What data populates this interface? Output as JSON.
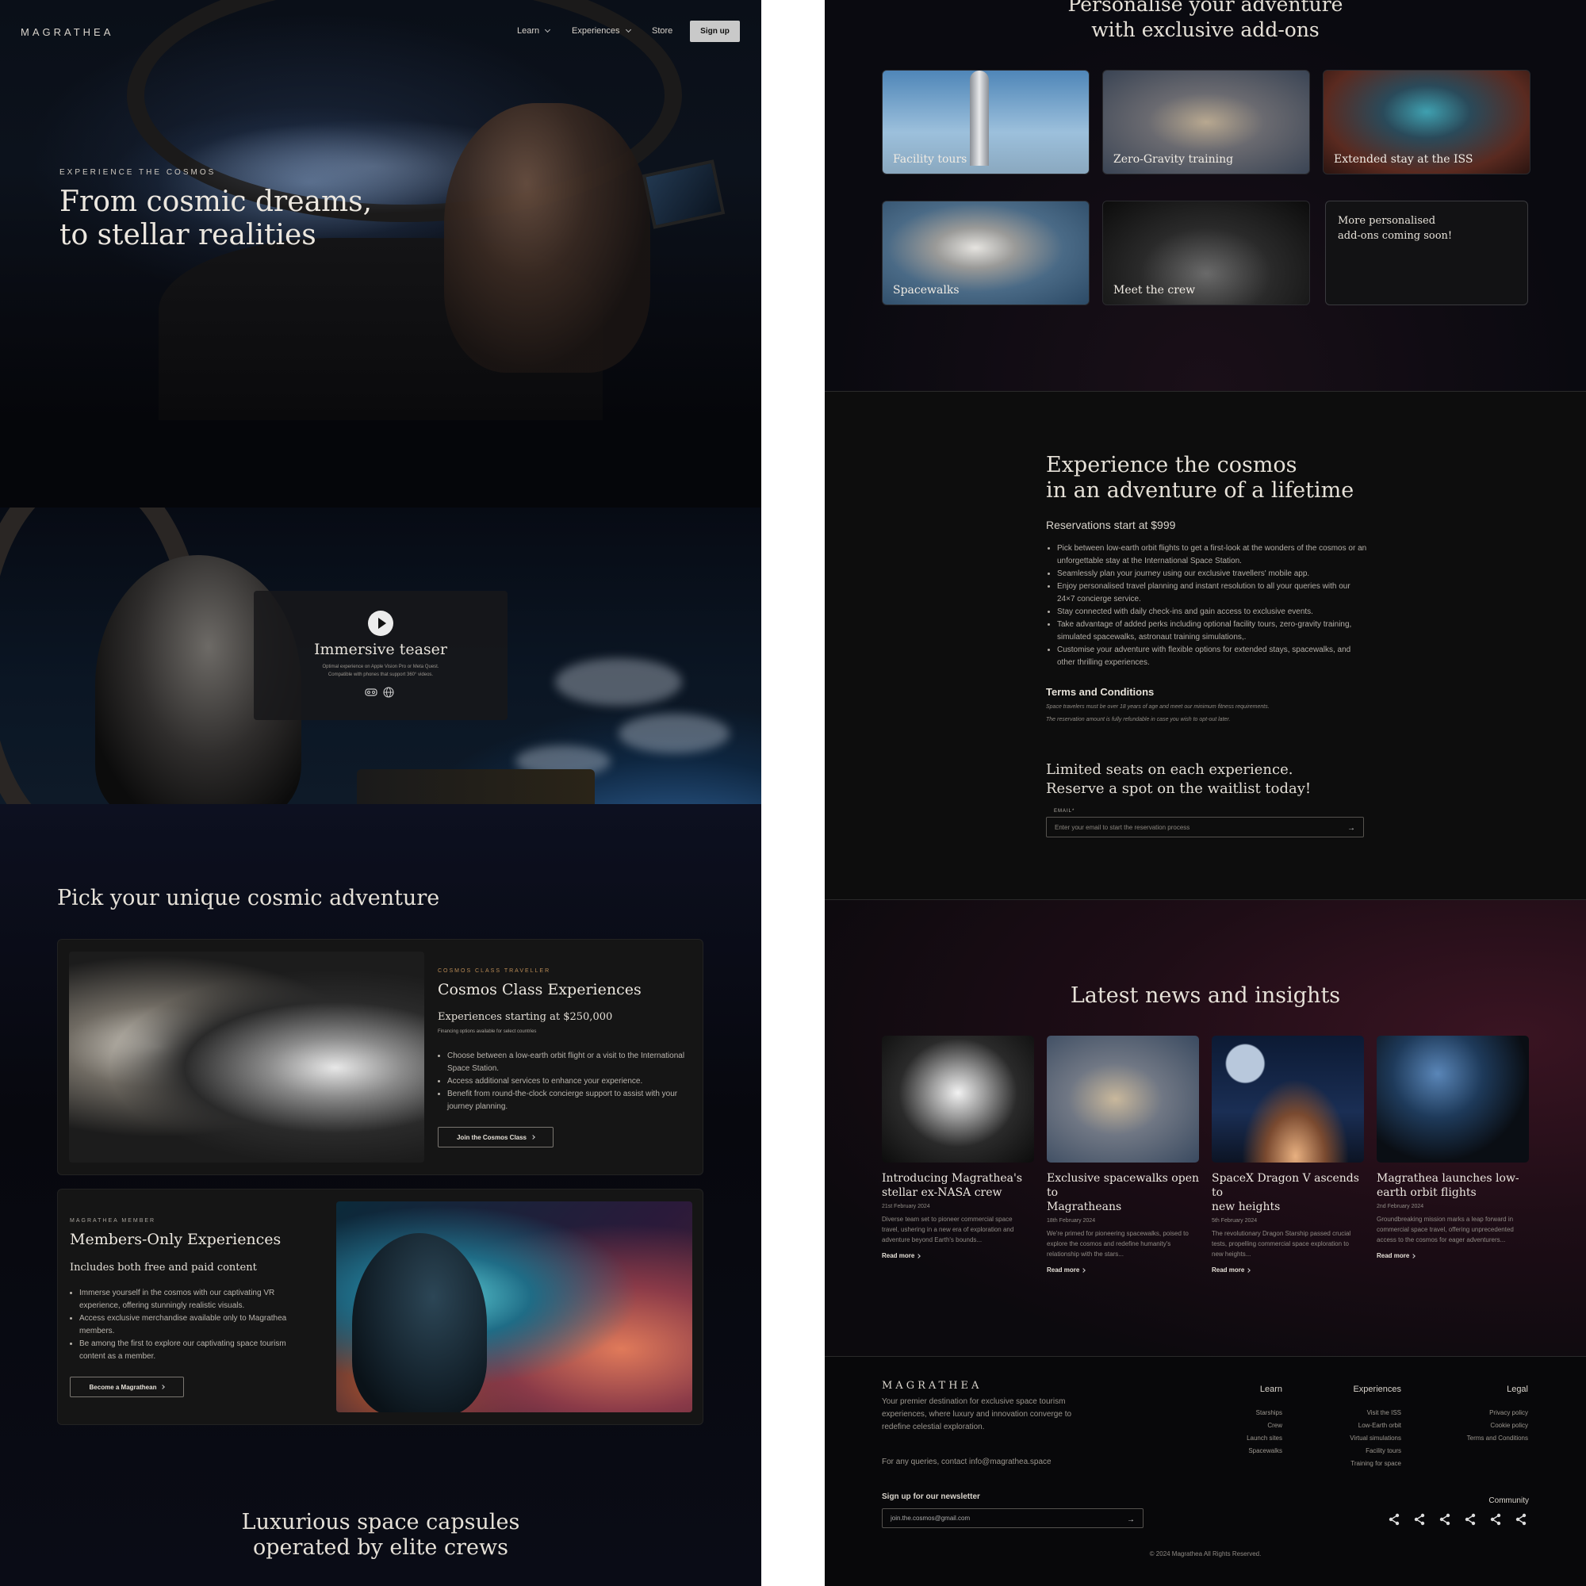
{
  "nav": {
    "logo": "MAGRATHEA",
    "items": [
      {
        "label": "Learn"
      },
      {
        "label": "Experiences"
      },
      {
        "label": "Store"
      }
    ],
    "signup": "Sign up"
  },
  "hero": {
    "kicker": "EXPERIENCE THE COSMOS",
    "line1": "From cosmic dreams,",
    "line2": "to stellar realities"
  },
  "teaser": {
    "title": "Immersive teaser",
    "sub1": "Optimal experience on Apple Vision Pro or Meta Quest.",
    "sub2": "Compatible with phones that support 360° videos.",
    "icons": [
      "vr-headset-icon",
      "globe-icon"
    ]
  },
  "adventure": {
    "heading": "Pick your unique cosmic adventure",
    "cosmos": {
      "kicker": "COSMOS CLASS TRAVELLER",
      "title": "Cosmos Class Experiences",
      "price": "Experiences starting at $250,000",
      "note": "Financing options available for select countries",
      "bullets": [
        "Choose between a low-earth orbit flight or a visit to the International Space Station.",
        "Access additional services to enhance your experience.",
        "Benefit from round-the-clock concierge support to assist with your journey planning."
      ],
      "cta": "Join the Cosmos Class"
    },
    "members": {
      "kicker": "MAGRATHEA MEMBER",
      "title": "Members-Only Experiences",
      "sub": "Includes both free and paid content",
      "bullets": [
        "Immerse yourself in the cosmos with our captivating VR experience, offering stunningly realistic visuals.",
        "Access exclusive merchandise available only to Magrathea members.",
        "Be among the first to explore our captivating space tourism content as a member."
      ],
      "cta": "Become a Magrathean"
    }
  },
  "capsules": {
    "line1": "Luxurious space capsules",
    "line2": "operated by elite crews"
  },
  "addons": {
    "line1": "Personalise your adventure",
    "line2": "with exclusive add-ons",
    "items": [
      {
        "label": "Facility tours"
      },
      {
        "label": "Zero-Gravity training"
      },
      {
        "label": "Extended stay at the ISS"
      },
      {
        "label": "Spacewalks"
      },
      {
        "label": "Meet the crew"
      }
    ],
    "coming_soon_1": "More personalised",
    "coming_soon_2": "add-ons coming soon!"
  },
  "reserve": {
    "line1": "Experience the cosmos",
    "line2": "in an adventure of a lifetime",
    "price": "Reservations start at $999",
    "bullets": [
      "Pick between low-earth orbit flights to get a first-look at the wonders of the cosmos or an unforgettable stay at the International Space Station.",
      "Seamlessly plan your journey using our exclusive travellers' mobile app.",
      "Enjoy personalised travel planning and instant resolution to all your queries with our 24×7 concierge service.",
      "Stay connected with daily check-ins and gain access to exclusive events.",
      "Take advantage of added perks including optional facility tours, zero-gravity training, simulated spacewalks, astronaut training simulations,.",
      "Customise your adventure with flexible options for extended stays, spacewalks, and other thrilling experiences."
    ],
    "terms_title": "Terms and Conditions",
    "terms1": "Space travelers must be over 18 years of age and meet our minimum fitness requirements.",
    "terms2": "The reservation amount is fully refundable in case you wish to opt-out later.",
    "wait1": "Limited seats on each experience.",
    "wait2": "Reserve a spot on the waitlist today!",
    "email_label": "EMAIL*",
    "email_placeholder": "Enter your email to start the reservation process"
  },
  "news": {
    "heading": "Latest news and insights",
    "items": [
      {
        "title1": "Introducing Magrathea's",
        "title2": "stellar ex-NASA crew",
        "date": "21st February 2024",
        "excerpt1": "Diverse team set to pioneer commercial space",
        "excerpt2": "travel, ushering in a new era of exploration and",
        "excerpt3": "adventure beyond Earth's bounds...",
        "more": "Read more"
      },
      {
        "title1": "Exclusive spacewalks open to",
        "title2": "Magratheans",
        "date": "18th February 2024",
        "excerpt1": "We're primed for pioneering spacewalks, poised to",
        "excerpt2": "explore the cosmos and redefine humanity's",
        "excerpt3": "relationship with the stars...",
        "more": "Read more"
      },
      {
        "title1": "SpaceX Dragon V ascends to",
        "title2": "new heights",
        "date": "5th February 2024",
        "excerpt1": "The revolutionary Dragon Starship passed crucial",
        "excerpt2": "tests, propelling commercial space exploration to",
        "excerpt3": "new heights...",
        "more": "Read more"
      },
      {
        "title1": "Magrathea launches low-",
        "title2": "earth orbit flights",
        "date": "2nd February 2024",
        "excerpt1": "Groundbreaking mission marks a leap forward in",
        "excerpt2": "commercial space travel, offering unprecedented",
        "excerpt3": "access to the cosmos for eager adventurers...",
        "more": "Read more"
      }
    ]
  },
  "footer": {
    "logo": "MAGRATHEA",
    "tag1": "Your premier destination for exclusive space tourism",
    "tag2": "experiences, where luxury and innovation converge to",
    "tag3": "redefine celestial exploration.",
    "contact": "For any queries, contact info@magrathea.space",
    "cols": [
      {
        "title": "Learn",
        "links": [
          "Starships",
          "Crew",
          "Launch sites",
          "Spacewalks"
        ]
      },
      {
        "title": "Experiences",
        "links": [
          "Visit the ISS",
          "Low-Earth orbit",
          "Virtual simulations",
          "Facility tours",
          "Training for space"
        ]
      },
      {
        "title": "Legal",
        "links": [
          "Privacy policy",
          "Cookie policy",
          "Terms and Conditions"
        ]
      }
    ],
    "newsletter_label": "Sign up for our newsletter",
    "newsletter_value": "join.the.cosmos@gmail.com",
    "community": "Community",
    "copyright": "© 2024 Magrathea All Rights Reserved."
  },
  "colors": {
    "bg": "#05060a",
    "panel": "#151515",
    "text": "#e6e2dc",
    "muted": "#9c978f",
    "accent_kicker": "#b88a55",
    "signup_bg": "#c9c9c9"
  }
}
